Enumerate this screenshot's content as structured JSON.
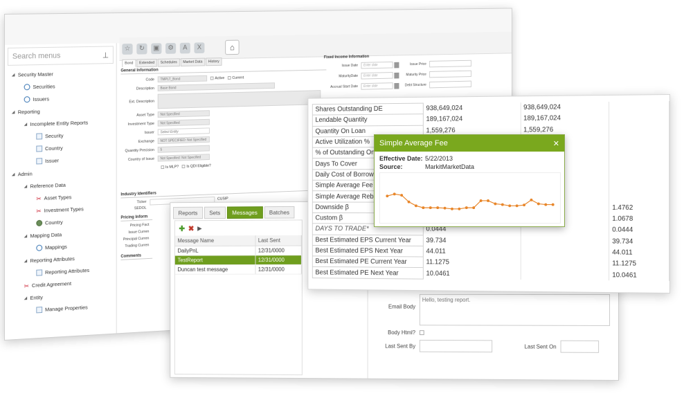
{
  "sidebar": {
    "search_placeholder": "Search menus",
    "items": [
      {
        "label": "Security Master",
        "level": 0,
        "icon": "expand-arrow"
      },
      {
        "label": "Securities",
        "level": 1,
        "icon": "search-icon"
      },
      {
        "label": "Issuers",
        "level": 1,
        "icon": "search-icon"
      },
      {
        "label": "Reporting",
        "level": 0,
        "icon": "expand-arrow"
      },
      {
        "label": "Incomplete Entity Reports",
        "level": 1,
        "icon": "expand-arrow"
      },
      {
        "label": "Security",
        "level": 2,
        "icon": "document-icon"
      },
      {
        "label": "Country",
        "level": 2,
        "icon": "document-icon"
      },
      {
        "label": "Issuer",
        "level": 2,
        "icon": "document-icon"
      },
      {
        "label": "Admin",
        "level": 0,
        "icon": "expand-arrow"
      },
      {
        "label": "Reference Data",
        "level": 1,
        "icon": "expand-arrow"
      },
      {
        "label": "Asset Types",
        "level": 2,
        "icon": "tool-icon"
      },
      {
        "label": "Investment Types",
        "level": 2,
        "icon": "tool-icon"
      },
      {
        "label": "Country",
        "level": 2,
        "icon": "globe-icon"
      },
      {
        "label": "Mapping Data",
        "level": 1,
        "icon": "expand-arrow"
      },
      {
        "label": "Mappings",
        "level": 2,
        "icon": "search-icon"
      },
      {
        "label": "Reporting Attributes",
        "level": 1,
        "icon": "expand-arrow"
      },
      {
        "label": "Reporting Attributes",
        "level": 2,
        "icon": "document-icon"
      },
      {
        "label": "Credit Agreement",
        "level": 1,
        "icon": "tool-icon"
      },
      {
        "label": "Entity",
        "level": 1,
        "icon": "expand-arrow"
      },
      {
        "label": "Manage Properties",
        "level": 2,
        "icon": "document-icon"
      }
    ]
  },
  "security_tabs": [
    "Bond",
    "Extended",
    "Schedules",
    "Market Data",
    "History"
  ],
  "general": {
    "title": "General Information",
    "code_label": "Code",
    "code_value": "TMPLT_Bond",
    "active_label": "Active",
    "current_label": "Current",
    "description_label": "Description",
    "description_value": "Base Bond",
    "ext_description_label": "Ext. Description",
    "asset_type_label": "Asset Type",
    "asset_type_value": "Not Specified",
    "investment_type_label": "Investment Type",
    "investment_type_value": "Not Specified",
    "issuer_label": "Issuer",
    "issuer_value": "Select Entity",
    "exchange_label": "Exchange",
    "exchange_value": "NOT SPECIFIED: Not Specified",
    "quantity_precision_label": "Quantity Precision",
    "quantity_precision_value": "5",
    "country_label": "Country of Issue",
    "country_value": "Not Specified: Not Specified",
    "is_mlp_label": "Is MLP?",
    "is_qdi_label": "Is QDI Eligible?"
  },
  "industry": {
    "title": "Industry Identifiers",
    "ticker_label": "Ticker",
    "cusip_label": "CUSIP",
    "sedol_label": "SEDOL"
  },
  "pricing": {
    "title": "Pricing Inform",
    "factor_label": "Pricing Fact",
    "issue_curr_label": "Issue Curren",
    "principal_curr_label": "Principal Curren",
    "trading_curr_label": "Trading Curren"
  },
  "comments_title": "Comments",
  "fixed_income": {
    "title": "Fixed Income Information",
    "issue_date_label": "Issue Date",
    "maturity_date_label": "MaturityDate",
    "accrual_label": "Accrual Start Date",
    "date_placeholder": "Enter date",
    "issue_price_label": "Issue Price",
    "maturity_price_label": "Maturity Price",
    "debt_label": "Debt Structure"
  },
  "messages_window": {
    "tabs": [
      "Reports",
      "Sets",
      "Messages",
      "Batches"
    ],
    "active_tab": "Messages",
    "col_name": "Message Name",
    "col_last_sent": "Last Sent",
    "rows": [
      {
        "name": "DailyPnL",
        "last_sent": "12/31/0000"
      },
      {
        "name": "TestReport",
        "last_sent": "12/31/0000"
      },
      {
        "name": "Duncan test message",
        "last_sent": "12/31/0000"
      }
    ],
    "selected_row": "TestReport",
    "email_body_label": "Email Body",
    "email_body_value": "Hello, testing report.",
    "body_html_label": "Body Html?",
    "last_sent_by_label": "Last Sent By",
    "last_sent_on_label": "Last Sent On"
  },
  "metrics": {
    "rows": [
      {
        "label": "Shares Outstanding DE",
        "v1": "938,649,024",
        "v2": "938,649,024",
        "v3": ""
      },
      {
        "label": "Lendable Quantity",
        "v1": "189,167,024",
        "v2": "189,167,024",
        "v3": ""
      },
      {
        "label": "Quantity On Loan",
        "v1": "1,559,276",
        "v2": "1,559,276",
        "v3": ""
      },
      {
        "label": "Active Utilization %",
        "v1": "",
        "v2": "",
        "v3": ""
      },
      {
        "label": "% of Outstanding On Loan",
        "v1": "",
        "v2": "",
        "v3": ""
      },
      {
        "label": "Days To Cover",
        "v1": "",
        "v2": "",
        "v3": ""
      },
      {
        "label": "Daily Cost of Borrow Score",
        "v1": "",
        "v2": "",
        "v3": ""
      },
      {
        "label": "Simple Average Fee",
        "v1": "",
        "v2": "",
        "v3": ""
      },
      {
        "label": "Simple Average Rebate",
        "v1": "",
        "v2": "",
        "v3": ""
      },
      {
        "label": "Downside β",
        "v1": "",
        "v2": "",
        "v3": "1.4762"
      },
      {
        "label": "Custom β",
        "v1": "",
        "v2": "",
        "v3": "1.0678"
      },
      {
        "label": "DAYS TO TRADE*",
        "v1": "0.0444",
        "v2": "",
        "v3": "0.0444",
        "italic": true
      },
      {
        "label": "Best Estimated EPS Current Year",
        "v1": "39.734",
        "v2": "",
        "v3": "39.734"
      },
      {
        "label": "Best Estimated EPS Next Year",
        "v1": "44.011",
        "v2": "",
        "v3": "44.011"
      },
      {
        "label": "Best Estimated PE Current Year",
        "v1": "11.1275",
        "v2": "",
        "v3": "11.1275"
      },
      {
        "label": "Best Estimated PE Next Year",
        "v1": "10.0461",
        "v2": "",
        "v3": "10.0461"
      }
    ]
  },
  "popup": {
    "title": "Simple Average Fee",
    "effective_label": "Effective Date:",
    "effective_value": "5/22/2013",
    "source_label": "Source:",
    "source_value": "MarkitMarketData",
    "line_color": "#e8862a"
  },
  "chart_data": {
    "type": "line",
    "title": "",
    "xlabel": "",
    "ylabel": "",
    "grid": false,
    "series": [
      {
        "values": [
          0.55,
          0.6,
          0.57,
          0.4,
          0.3,
          0.25,
          0.25,
          0.25,
          0.24,
          0.22,
          0.22,
          0.25,
          0.25,
          0.43,
          0.43,
          0.35,
          0.33,
          0.3,
          0.3,
          0.32,
          0.45,
          0.35,
          0.33,
          0.33
        ]
      }
    ],
    "ylim": [
      0,
      1
    ]
  }
}
